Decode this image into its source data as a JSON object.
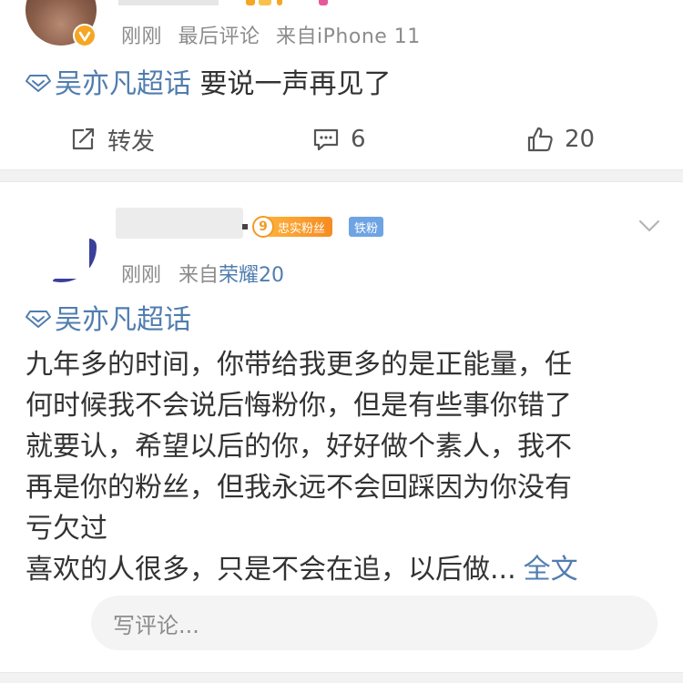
{
  "post1": {
    "meta": {
      "time": "刚刚",
      "activity": "最后评论",
      "source": "来自iPhone 11"
    },
    "topic": "吴亦凡超话",
    "text": "要说一声再见了",
    "actions": {
      "repost_label": "转发",
      "comment_count": "6",
      "like_count": "20"
    }
  },
  "post2": {
    "fan_badge": {
      "level": "9",
      "label": "忠实粉丝"
    },
    "iron_badge": "铁粉",
    "meta": {
      "time": "刚刚",
      "source_prefix": "来自",
      "source_device": "荣耀20"
    },
    "topic": "吴亦凡超话",
    "lines": [
      "九年多的时间，你带给我更多的是正能量，任",
      "何时候我不会说后悔粉你，但是有些事你错了",
      "就要认，希望以后的你，好好做个素人，我不",
      "再是你的粉丝，但我永远不会回踩因为你没有",
      "亏欠过",
      "喜欢的人很多，只是不会在追，以后做..."
    ],
    "full_text_link": "全文",
    "comment_placeholder": "写评论..."
  },
  "colors": {
    "link_blue": "#507daf",
    "meta_gray": "#8c8c8c",
    "fan_orange": "#f39a26",
    "iron_blue": "#6ea4e4",
    "verified_badge": "#f5a623"
  },
  "icons": [
    "verified-badge-icon",
    "supertopic-diamond-icon",
    "repost-icon",
    "comment-icon",
    "like-icon",
    "chevron-down-icon"
  ]
}
